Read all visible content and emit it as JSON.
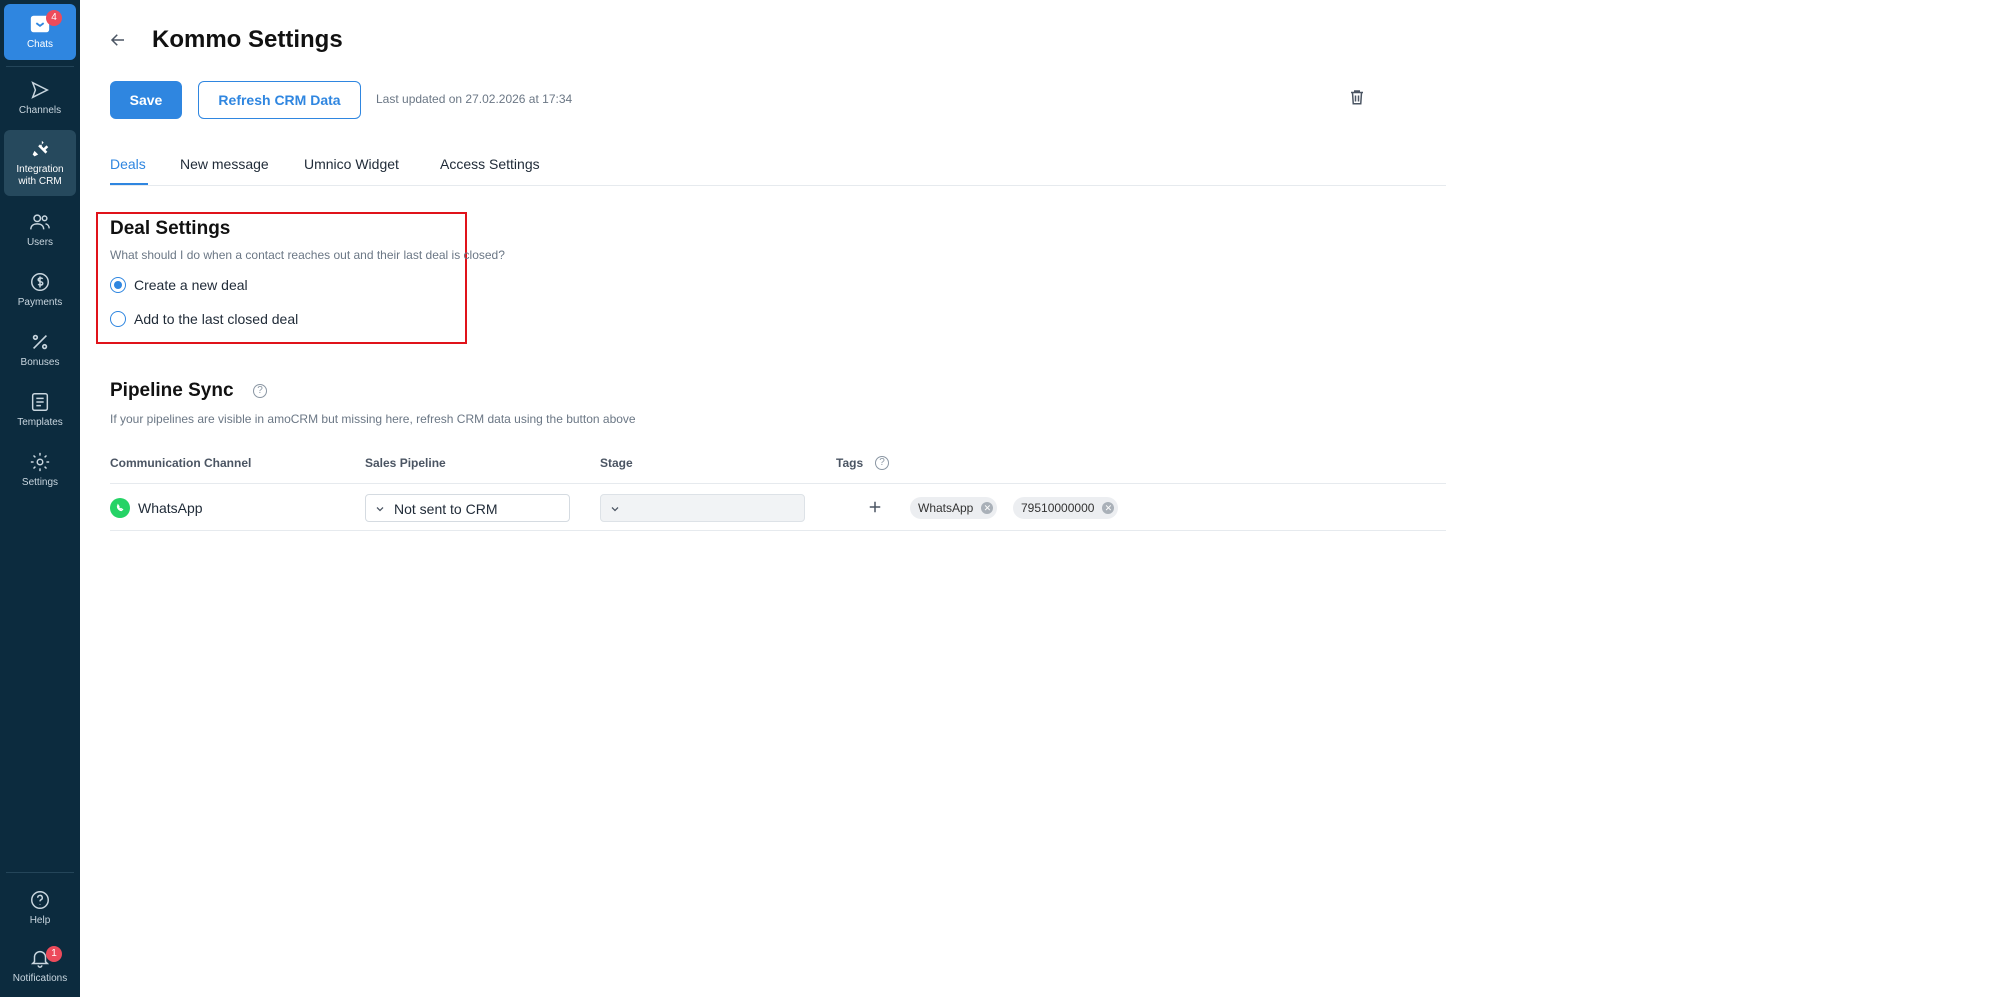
{
  "sidebar": {
    "items": [
      {
        "label": "Chats",
        "badge": "4",
        "icon": "chat-inbox-icon"
      },
      {
        "label": "Channels",
        "icon": "send-icon"
      },
      {
        "label": "Integration with CRM",
        "icon": "plug-icon"
      },
      {
        "label": "Users",
        "icon": "users-icon"
      },
      {
        "label": "Payments",
        "icon": "dollar-icon"
      },
      {
        "label": "Bonuses",
        "icon": "percent-icon"
      },
      {
        "label": "Templates",
        "icon": "template-icon"
      },
      {
        "label": "Settings",
        "icon": "gear-icon"
      }
    ],
    "bottom": [
      {
        "label": "Help",
        "icon": "help-icon"
      },
      {
        "label": "Notifications",
        "badge": "1",
        "icon": "bell-icon"
      }
    ]
  },
  "header": {
    "title": "Kommo Settings",
    "save_label": "Save",
    "refresh_label": "Refresh CRM Data",
    "last_updated": "Last updated on 27.02.2026 at 17:34"
  },
  "tabs": [
    {
      "label": "Deals",
      "active": true
    },
    {
      "label": "New message"
    },
    {
      "label": "Umnico Widget"
    },
    {
      "label": "Access Settings"
    }
  ],
  "deal_settings": {
    "title": "Deal Settings",
    "question": "What should I do when a contact reaches out and their last deal is closed?",
    "options": [
      {
        "label": "Create a new deal",
        "selected": true
      },
      {
        "label": "Add to the last closed deal",
        "selected": false
      }
    ]
  },
  "pipeline_sync": {
    "title": "Pipeline Sync",
    "subtitle": "If your pipelines are visible in amoCRM but missing here, refresh CRM data using the button above",
    "columns": [
      "Communication Channel",
      "Sales Pipeline",
      "Stage",
      "Tags"
    ],
    "rows": [
      {
        "channel": "WhatsApp",
        "pipeline": "Not sent to CRM",
        "stage": "",
        "tags": [
          "WhatsApp",
          "79510000000"
        ]
      }
    ]
  },
  "colors": {
    "accent": "#2f86e0",
    "sidebar": "#0c2b3e",
    "highlight": "#e0131a",
    "badge": "#ec4b5b"
  }
}
